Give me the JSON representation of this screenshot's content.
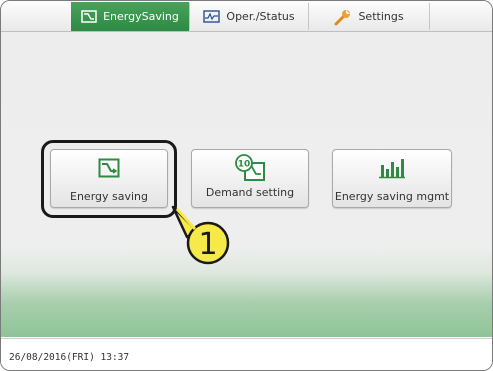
{
  "tabs": [
    {
      "label": "EnergySaving",
      "icon": "energy-saving-icon",
      "active": true
    },
    {
      "label": "Oper./Status",
      "icon": "pulse-monitor-icon",
      "active": false
    },
    {
      "label": "Settings",
      "icon": "wrench-icon",
      "active": false
    }
  ],
  "buttons": {
    "energy_saving": {
      "label": "Energy saving",
      "icon": "energy-saving-icon"
    },
    "demand_setting": {
      "label": "Demand setting",
      "icon": "demand-setting-icon",
      "icon_text": "10"
    },
    "energy_saving_mgmt": {
      "label": "Energy saving mgmt",
      "icon": "bar-chart-icon"
    }
  },
  "callout": {
    "number": "1"
  },
  "footer": {
    "datetime": "26/08/2016(FRI) 13:37"
  },
  "colors": {
    "accent_green": "#2e8a44",
    "callout_fill": "#f7e94a"
  }
}
